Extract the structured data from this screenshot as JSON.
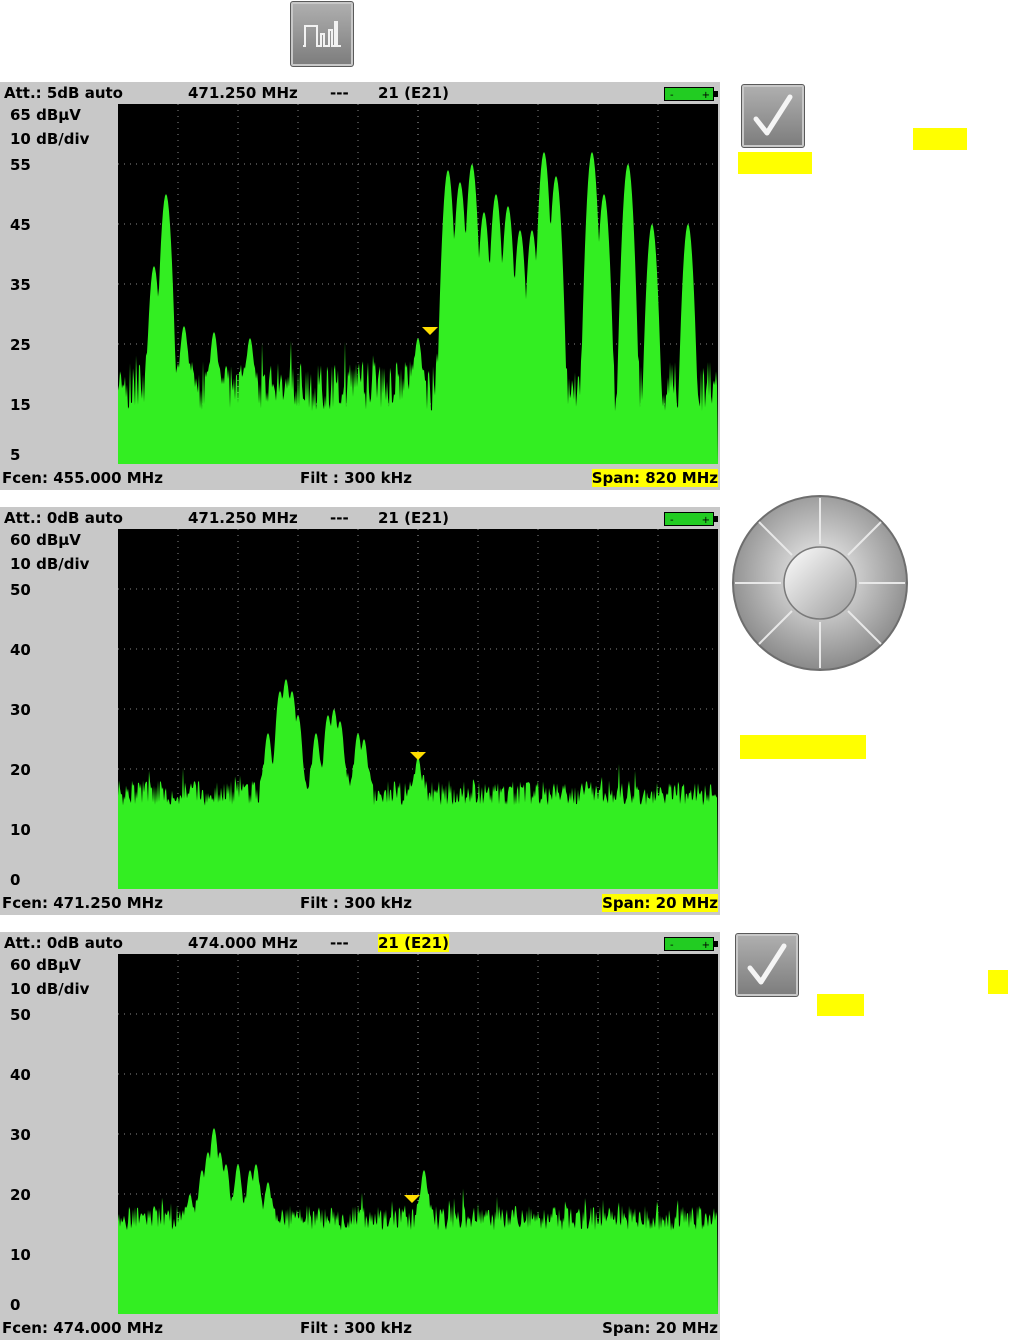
{
  "colors": {
    "highlight": "#ffff00",
    "trace": "#33ee22",
    "marker": "#ffdd00",
    "screen_bg": "#c8c8c8"
  },
  "icons": {
    "top": "spectrum-pulse-icon",
    "ok": "checkmark-icon",
    "knob": "navigation-knob-icon"
  },
  "screens": [
    {
      "att": "Att.: 5dB auto",
      "freq": "471.250 MHz",
      "dashes": "---",
      "channel": "21 (E21)",
      "channel_highlighted": false,
      "ref_level": "65 dBμV",
      "scale": "10 dB/div",
      "y_ticks": [
        "55",
        "45",
        "35",
        "25",
        "15",
        "5"
      ],
      "fcen": "Fcen: 455.000 MHz",
      "filt": "Filt : 300 kHz",
      "span": "Span: 820 MHz",
      "span_highlighted": true,
      "chart_data": {
        "type": "area",
        "ylim": [
          5,
          65
        ],
        "floor": 18,
        "noise_amp": 6,
        "marker_x": 0.52,
        "marker_y": 26,
        "peaks": [
          {
            "x": 0.06,
            "y": 38
          },
          {
            "x": 0.08,
            "y": 50
          },
          {
            "x": 0.11,
            "y": 28
          },
          {
            "x": 0.16,
            "y": 27
          },
          {
            "x": 0.22,
            "y": 26
          },
          {
            "x": 0.5,
            "y": 26
          },
          {
            "x": 0.55,
            "y": 54
          },
          {
            "x": 0.57,
            "y": 52
          },
          {
            "x": 0.59,
            "y": 55
          },
          {
            "x": 0.61,
            "y": 47
          },
          {
            "x": 0.63,
            "y": 50
          },
          {
            "x": 0.65,
            "y": 48
          },
          {
            "x": 0.67,
            "y": 44
          },
          {
            "x": 0.69,
            "y": 44
          },
          {
            "x": 0.71,
            "y": 57
          },
          {
            "x": 0.73,
            "y": 53
          },
          {
            "x": 0.79,
            "y": 57
          },
          {
            "x": 0.81,
            "y": 50
          },
          {
            "x": 0.85,
            "y": 55
          },
          {
            "x": 0.89,
            "y": 45
          },
          {
            "x": 0.95,
            "y": 45
          }
        ]
      }
    },
    {
      "att": "Att.: 0dB auto",
      "freq": "471.250 MHz",
      "dashes": "---",
      "channel": "21 (E21)",
      "channel_highlighted": false,
      "ref_level": "60 dBμV",
      "scale": "10 dB/div",
      "y_ticks": [
        "50",
        "40",
        "30",
        "20",
        "10",
        "0"
      ],
      "fcen": "Fcen: 471.250 MHz",
      "filt": "Filt : 300 kHz",
      "span": "Span:  20 MHz",
      "span_highlighted": true,
      "chart_data": {
        "type": "area",
        "ylim": [
          0,
          60
        ],
        "floor": 16,
        "noise_amp": 3,
        "marker_x": 0.5,
        "marker_y": 21,
        "peaks": [
          {
            "x": 0.25,
            "y": 26
          },
          {
            "x": 0.27,
            "y": 33
          },
          {
            "x": 0.28,
            "y": 35
          },
          {
            "x": 0.29,
            "y": 33
          },
          {
            "x": 0.3,
            "y": 29
          },
          {
            "x": 0.33,
            "y": 26
          },
          {
            "x": 0.35,
            "y": 29
          },
          {
            "x": 0.36,
            "y": 30
          },
          {
            "x": 0.37,
            "y": 28
          },
          {
            "x": 0.4,
            "y": 26
          },
          {
            "x": 0.41,
            "y": 25
          },
          {
            "x": 0.5,
            "y": 22
          }
        ]
      }
    },
    {
      "att": "Att.: 0dB auto",
      "freq": "474.000 MHz",
      "dashes": "---",
      "channel": "21 (E21)",
      "channel_highlighted": true,
      "ref_level": "60 dBμV",
      "scale": "10 dB/div",
      "y_ticks": [
        "50",
        "40",
        "30",
        "20",
        "10",
        "0"
      ],
      "fcen": "Fcen: 474.000 MHz",
      "filt": "Filt : 300 kHz",
      "span": "Span:  20 MHz",
      "span_highlighted": false,
      "chart_data": {
        "type": "area",
        "ylim": [
          0,
          60
        ],
        "floor": 16,
        "noise_amp": 3,
        "marker_x": 0.49,
        "marker_y": 18,
        "peaks": [
          {
            "x": 0.12,
            "y": 20
          },
          {
            "x": 0.14,
            "y": 24
          },
          {
            "x": 0.15,
            "y": 27
          },
          {
            "x": 0.16,
            "y": 31
          },
          {
            "x": 0.17,
            "y": 27
          },
          {
            "x": 0.18,
            "y": 25
          },
          {
            "x": 0.2,
            "y": 25
          },
          {
            "x": 0.22,
            "y": 24
          },
          {
            "x": 0.23,
            "y": 25
          },
          {
            "x": 0.25,
            "y": 22
          },
          {
            "x": 0.51,
            "y": 24
          }
        ]
      }
    }
  ]
}
